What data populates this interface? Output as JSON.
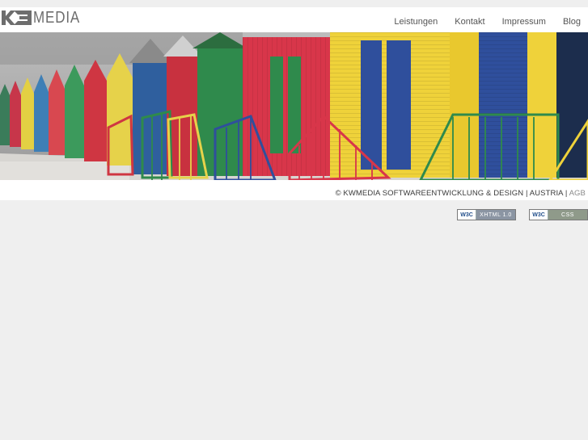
{
  "logo": {
    "mark_text": "KW",
    "text": "MEDIA"
  },
  "nav": {
    "items": [
      {
        "label": "Leistungen"
      },
      {
        "label": "Kontakt"
      },
      {
        "label": "Impressum"
      },
      {
        "label": "Blog"
      }
    ]
  },
  "footer": {
    "copyright": "© KWMEDIA SOFTWAREENTWICKLUNG & DESIGN | AUSTRIA |",
    "agb_link": "AGB"
  },
  "badges": {
    "xhtml": {
      "w3c": "W3C",
      "label": "XHTML 1.0",
      "color": "#8b95a3"
    },
    "css": {
      "w3c": "W3C",
      "label": "CSS",
      "color": "#8f9a8a"
    }
  },
  "colors": {
    "background": "#efefef",
    "header": "#ffffff",
    "nav_text": "#555555"
  }
}
